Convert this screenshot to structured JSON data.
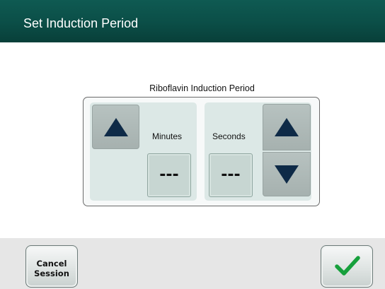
{
  "header": {
    "title": "Set Induction Period"
  },
  "induction_panel": {
    "title": "Riboflavin Induction Period",
    "minutes": {
      "label": "Minutes",
      "value": "---",
      "up_icon": "triangle-up-icon"
    },
    "seconds": {
      "label": "Seconds",
      "value": "---",
      "up_icon": "triangle-up-icon",
      "down_icon": "triangle-down-icon"
    }
  },
  "footer": {
    "cancel_label": "Cancel\nSession",
    "confirm_icon": "checkmark-icon"
  },
  "colors": {
    "header": "#0b4e47",
    "arrow": "#0e2a47",
    "check": "#16a03c",
    "subpanel": "#dce8e6"
  }
}
